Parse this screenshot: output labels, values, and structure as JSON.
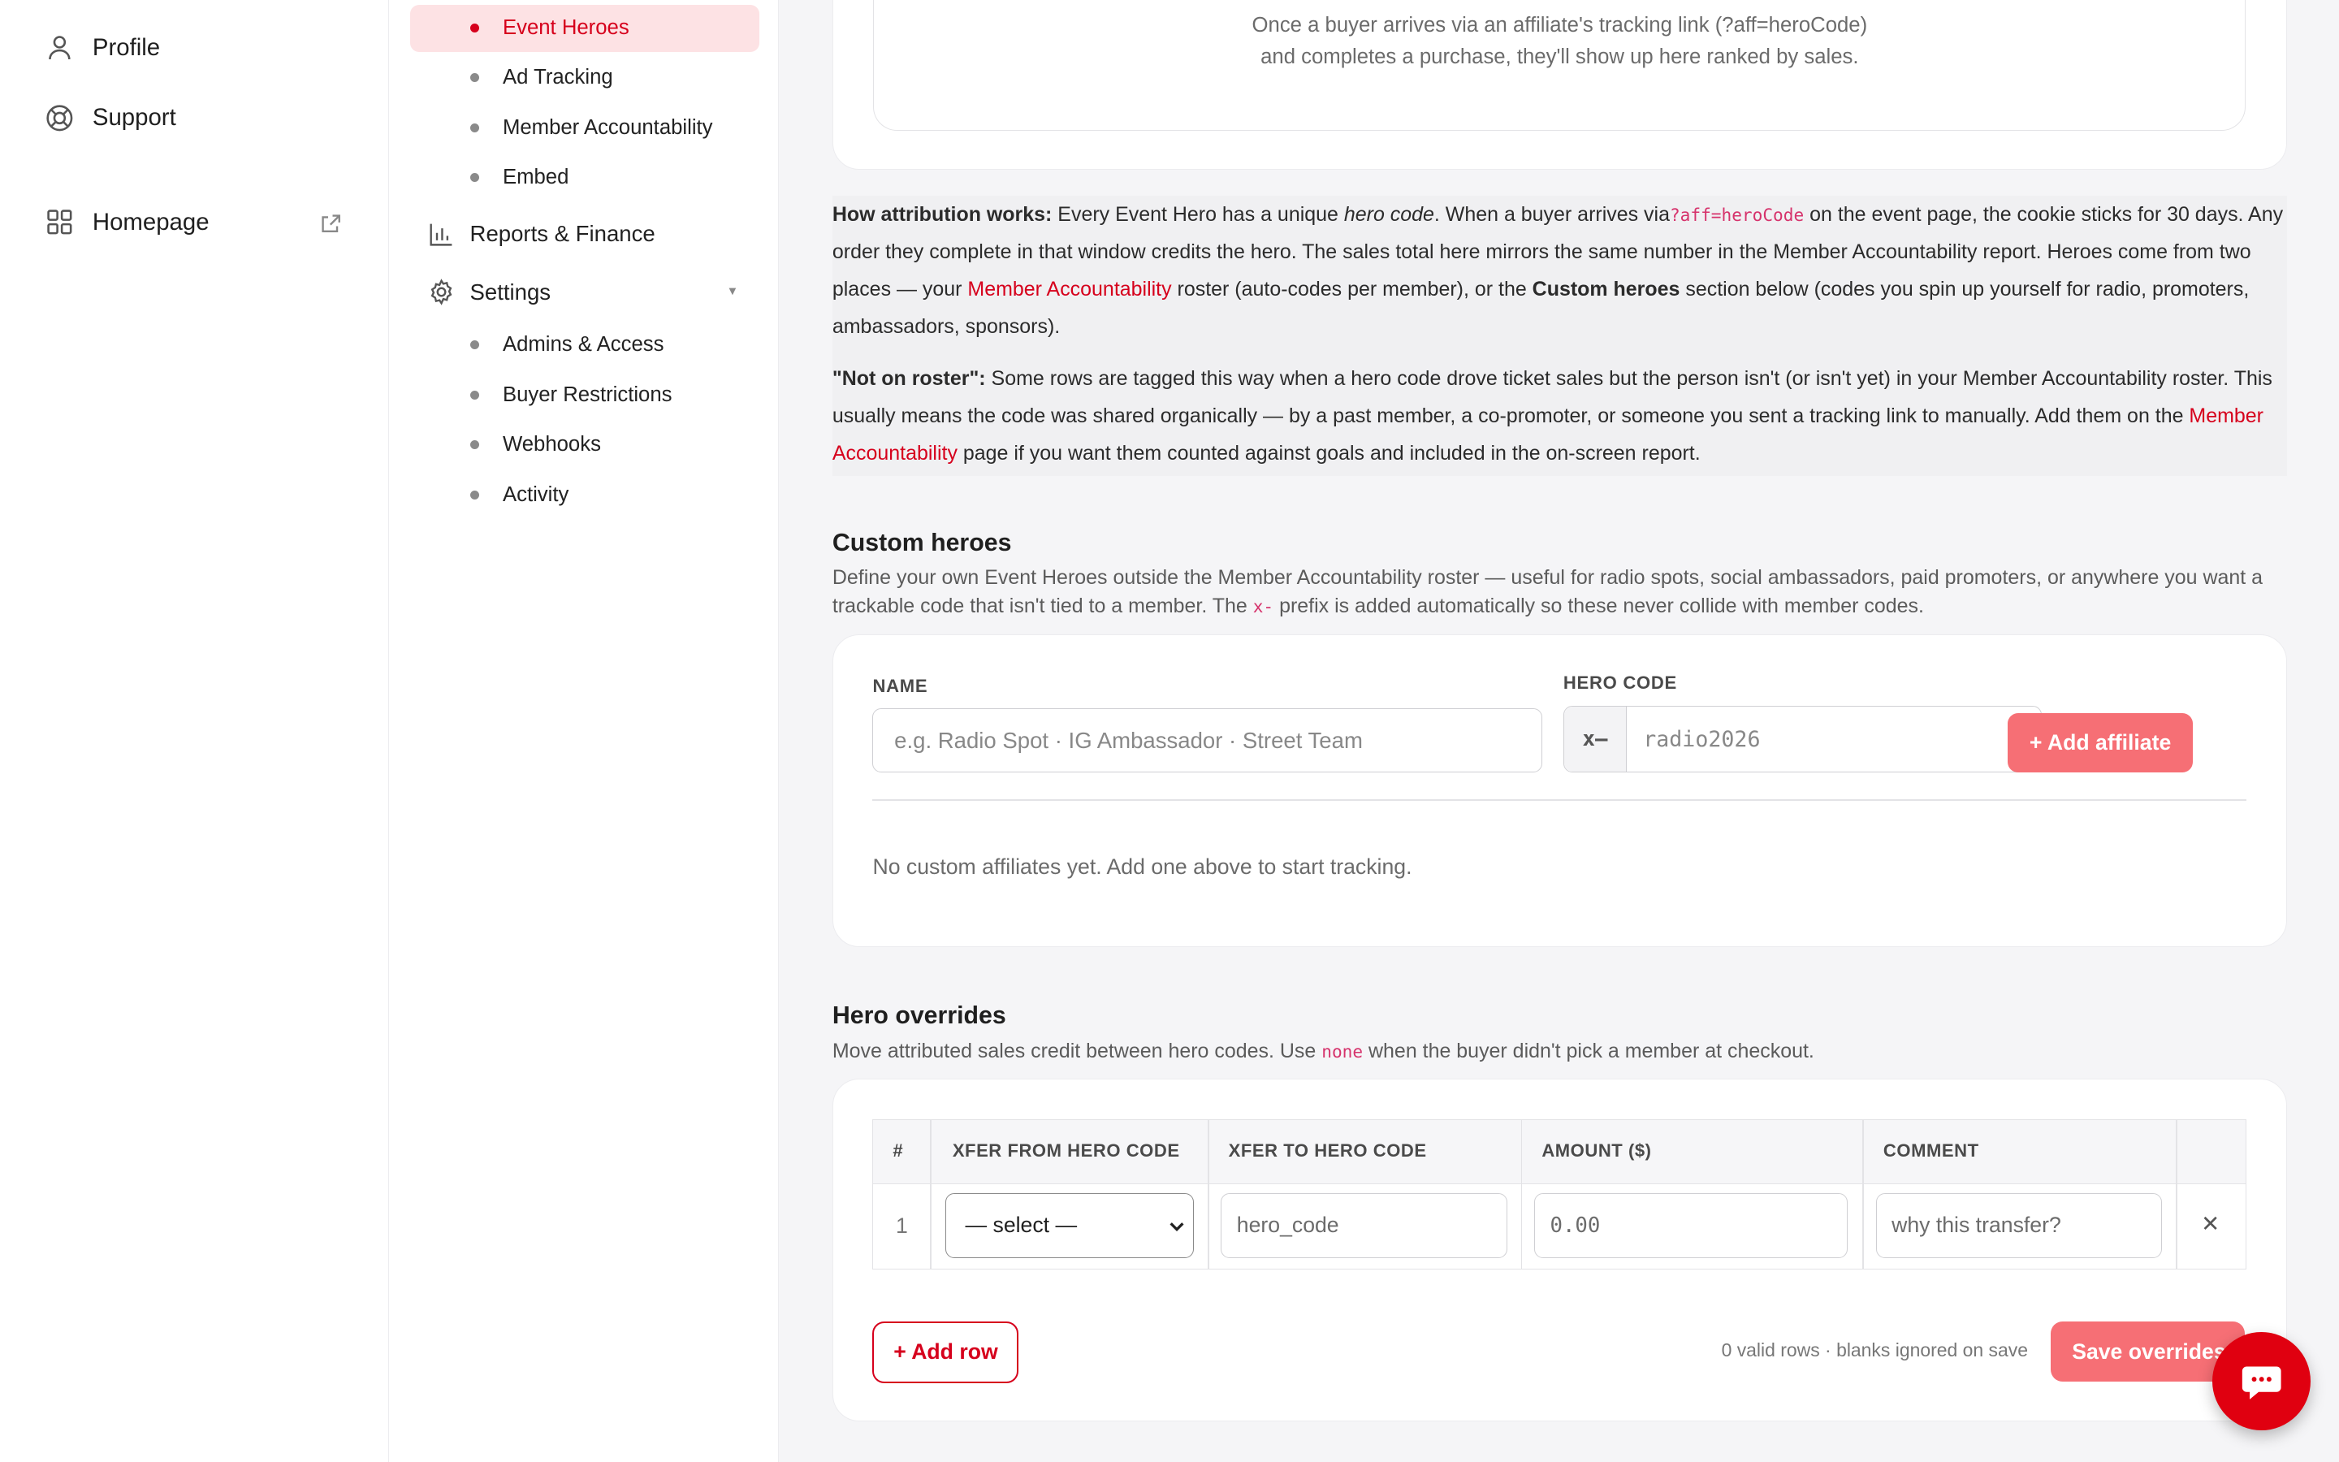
{
  "rail": {
    "profile": "Profile",
    "support": "Support",
    "homepage": "Homepage"
  },
  "subnav": {
    "items": [
      "Event Heroes",
      "Ad Tracking",
      "Member Accountability",
      "Embed"
    ],
    "reports": "Reports & Finance",
    "settings": "Settings",
    "settings_items": [
      "Admins & Access",
      "Buyer Restrictions",
      "Webhooks",
      "Activity"
    ]
  },
  "leaderboard_empty": {
    "line1": "Once a buyer arrives via an affiliate's tracking link (?aff=heroCode)",
    "line2": "and completes a purchase, they'll show up here ranked by sales."
  },
  "info": {
    "p1_bold": "How attribution works:",
    "p1_a": " Every Event Hero has a unique ",
    "p1_em": "hero code",
    "p1_b": ". When a buyer arrives via",
    "p1_code": "?aff=heroCode",
    "p1_c": " on the event page, the cookie sticks for 30 days. Any order they complete in that window credits the hero. The sales total here mirrors the same number in the Member Accountability report. Heroes come from two places — your ",
    "p1_link": "Member Accountability",
    "p1_d": " roster (auto-codes per member), or the ",
    "p1_bold2": "Custom heroes",
    "p1_e": " section below (codes you spin up yourself for radio, promoters, ambassadors, sponsors).",
    "p2_bold": "\"Not on roster\":",
    "p2_a": " Some rows are tagged this way when a hero code drove ticket sales but the person isn't (or isn't yet) in your Member Accountability roster. This usually means the code was shared organically — by a past member, a co-promoter, or someone you sent a tracking link to manually. Add them on the ",
    "p2_link": "Member Accountability",
    "p2_b": " page if you want them counted against goals and included in the on-screen report."
  },
  "custom": {
    "title": "Custom heroes",
    "desc_a": "Define your own Event Heroes outside the Member Accountability roster — useful for radio spots, social ambassadors, paid promoters, or anywhere you want a trackable code that isn't tied to a member. The ",
    "desc_code": "x-",
    "desc_b": " prefix is added automatically so these never collide with member codes.",
    "name_label": "NAME",
    "name_placeholder": "e.g. Radio Spot · IG Ambassador · Street Team",
    "code_label": "HERO CODE",
    "code_prefix": "x–",
    "code_placeholder": "radio2026",
    "add_button": "+ Add affiliate",
    "empty": "No custom affiliates yet. Add one above to start tracking."
  },
  "overrides": {
    "title": "Hero overrides",
    "desc_a": "Move attributed sales credit between hero codes. Use ",
    "desc_code": "none",
    "desc_b": " when the buyer didn't pick a member at checkout.",
    "headers": [
      "#",
      "XFER FROM HERO CODE",
      "XFER TO HERO CODE",
      "AMOUNT ($)",
      "COMMENT"
    ],
    "row": {
      "num": "1",
      "from_selected": "— select —",
      "to_placeholder": "hero_code",
      "amount_placeholder": "0.00",
      "comment_placeholder": "why this transfer?",
      "remove": "✕"
    },
    "add_row": "+ Add row",
    "status": "0 valid rows · blanks ignored on save",
    "save": "Save overrides"
  },
  "colors": {
    "accent": "#d6001c",
    "accent_soft": "#f66f75",
    "active_bg": "#fde2e4"
  }
}
